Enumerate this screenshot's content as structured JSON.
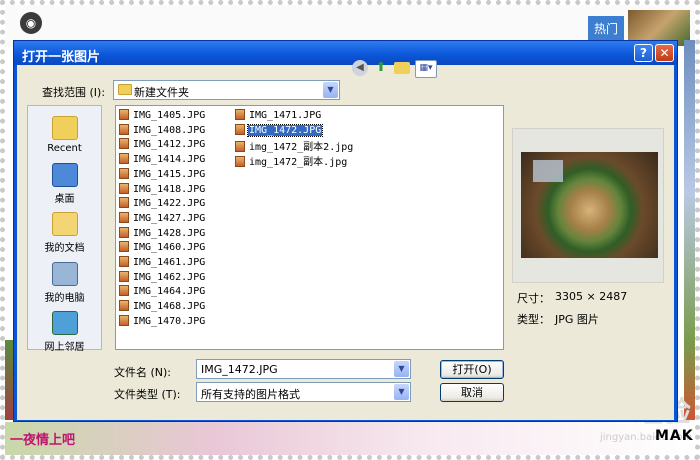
{
  "background": {
    "hot_tab": "热门",
    "bottom_caption": "一夜情上吧",
    "brand_text": "MAK",
    "watermark": "Baidu经验",
    "watermark_sub": "jingyan.baidu.com"
  },
  "dialog": {
    "title": "打开一张图片",
    "help_label": "?",
    "close_label": "✕",
    "look_in_label": "查找范围 (I):",
    "current_folder": "新建文件夹",
    "places": [
      {
        "label": "Recent",
        "icon": "recent-folder-icon"
      },
      {
        "label": "桌面",
        "icon": "desktop-icon"
      },
      {
        "label": "我的文档",
        "icon": "my-documents-icon"
      },
      {
        "label": "我的电脑",
        "icon": "my-computer-icon"
      },
      {
        "label": "网上邻居",
        "icon": "network-icon"
      }
    ],
    "files_col1": [
      "IMG_1405.JPG",
      "IMG_1408.JPG",
      "IMG_1412.JPG",
      "IMG_1414.JPG",
      "IMG_1415.JPG",
      "IMG_1418.JPG",
      "IMG_1422.JPG",
      "IMG_1427.JPG",
      "IMG_1428.JPG",
      "IMG_1460.JPG",
      "IMG_1461.JPG",
      "IMG_1462.JPG",
      "IMG_1464.JPG",
      "IMG_1468.JPG",
      "IMG_1470.JPG"
    ],
    "files_col2": [
      "IMG_1471.JPG",
      "IMG_1472.JPG",
      "img_1472_副本2.jpg",
      "img_1472_副本.jpg"
    ],
    "selected_file": "IMG_1472.JPG",
    "size_label": "尺寸：",
    "size_value": "3305 × 2487",
    "type_label": "类型：",
    "type_value": "JPG 图片",
    "filename_label": "文件名 (N):",
    "filename_value": "IMG_1472.JPG",
    "filetype_label": "文件类型 (T):",
    "filetype_value": "所有支持的图片格式",
    "open_button": "打开(O)",
    "cancel_button": "取消"
  }
}
